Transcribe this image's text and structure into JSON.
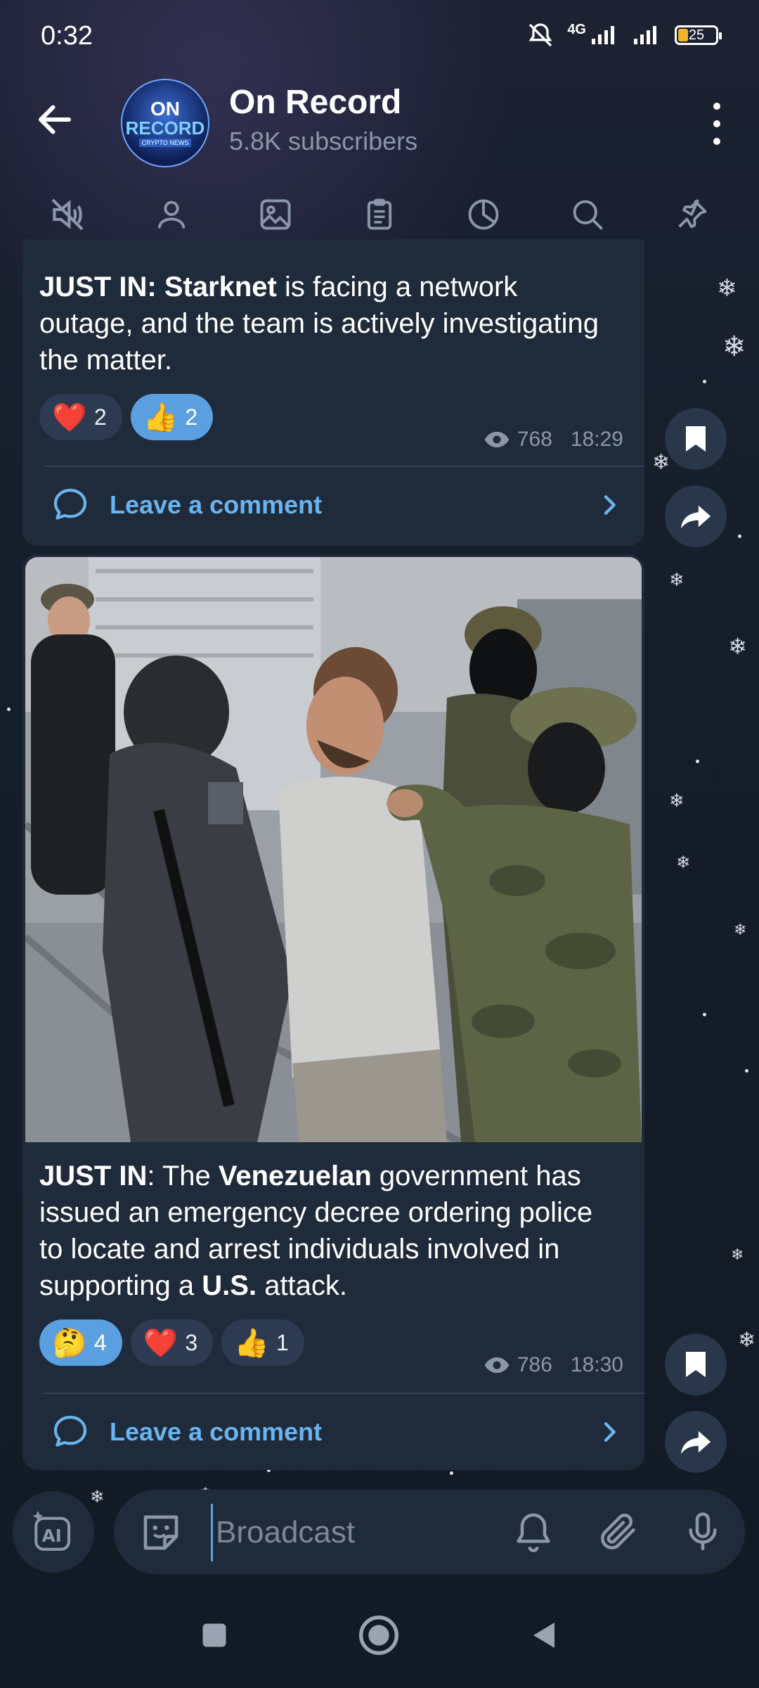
{
  "status_bar": {
    "time": "0:32",
    "network": "4G",
    "battery": "25"
  },
  "header": {
    "channel_name": "On Record",
    "subscribers": "5.8K subscribers",
    "avatar_text": {
      "line1": "ON",
      "line2": "RECORD",
      "line3": "CRYPTO NEWS"
    }
  },
  "toolbar": {
    "icons": [
      "mute-icon",
      "members-icon",
      "media-icon",
      "files-icon",
      "stats-icon",
      "search-icon",
      "pin-icon"
    ]
  },
  "messages": [
    {
      "text_parts": [
        {
          "t": "JUST IN:",
          "b": true
        },
        {
          "t": " ",
          "b": false
        },
        {
          "t": "Starknet",
          "b": true
        },
        {
          "t": " is facing a network outage, and the team is actively investigating the matter.",
          "b": false
        }
      ],
      "reactions": [
        {
          "emoji": "❤️",
          "count": "2",
          "active": false
        },
        {
          "emoji": "👍",
          "count": "2",
          "active": true
        }
      ],
      "views": "768",
      "time": "18:29",
      "comment_label": "Leave a comment"
    },
    {
      "text_parts": [
        {
          "t": "JUST IN",
          "b": true
        },
        {
          "t": ": The ",
          "b": false
        },
        {
          "t": "Venezuelan",
          "b": true
        },
        {
          "t": " government has issued an emergency decree ordering police to locate and arrest individuals involved in supporting a ",
          "b": false
        },
        {
          "t": "U.S.",
          "b": true
        },
        {
          "t": " attack.",
          "b": false
        }
      ],
      "reactions": [
        {
          "emoji": "🤔",
          "count": "4",
          "active": true
        },
        {
          "emoji": "❤️",
          "count": "3",
          "active": false
        },
        {
          "emoji": "👍",
          "count": "1",
          "active": false
        }
      ],
      "views": "786",
      "time": "18:30",
      "comment_label": "Leave a comment"
    }
  ],
  "input": {
    "placeholder": "Broadcast"
  },
  "colors": {
    "accent": "#5aa0e0",
    "link": "#69b4f0",
    "bubble": "#1f2a3a",
    "background": "#121a25"
  }
}
